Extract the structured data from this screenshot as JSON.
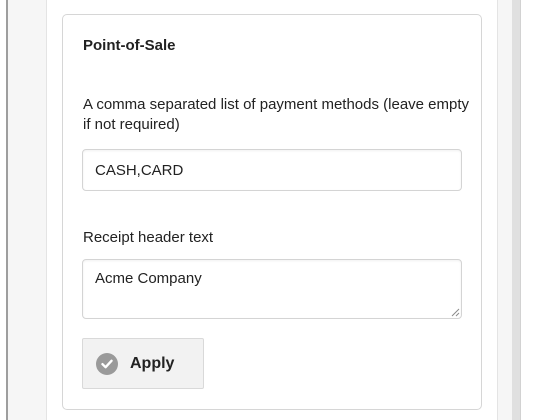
{
  "section": {
    "title": "Point-of-Sale"
  },
  "fields": {
    "payment_methods": {
      "label": "A comma separated list of payment methods (leave empty if not required)",
      "value": "CASH,CARD"
    },
    "receipt_header": {
      "label": "Receipt header text",
      "value": "Acme Company"
    }
  },
  "actions": {
    "apply_label": "Apply",
    "apply_icon": "check-circle-icon"
  },
  "colors": {
    "card_border": "#d6d6d6",
    "button_background": "#f2f2f2",
    "icon_gray": "#9a9a9a"
  }
}
